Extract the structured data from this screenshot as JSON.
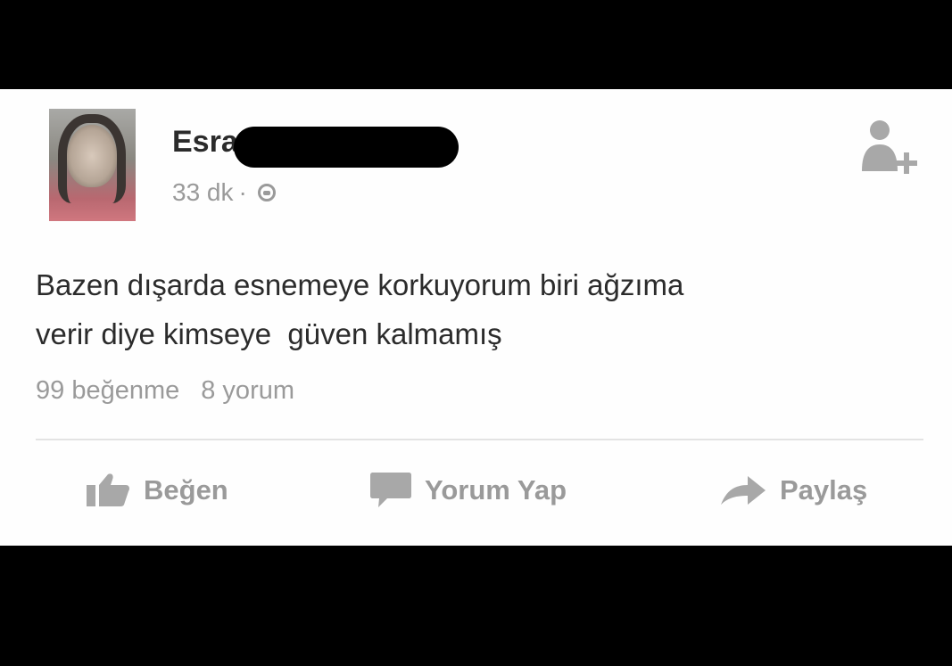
{
  "post": {
    "author": "Esra",
    "time": "33 dk",
    "separator": "·",
    "text": "Bazen dışarda esnemeye korkuyorum biri ağzıma\nverir diye kimseye  güven kalmamış",
    "likes": "99 beğenme",
    "comments": "8 yorum"
  },
  "actions": {
    "like_label": "Beğen",
    "comment_label": "Yorum Yap",
    "share_label": "Paylaş"
  },
  "icons": {
    "add_friend": "add-friend-icon",
    "privacy": "globe-icon",
    "like": "thumbs-up-icon",
    "comment": "speech-bubble-icon",
    "share": "share-arrow-icon"
  },
  "colors": {
    "background": "#000000",
    "card": "#fefefe",
    "text": "#2b2b2b",
    "muted": "#9a9a9a"
  }
}
